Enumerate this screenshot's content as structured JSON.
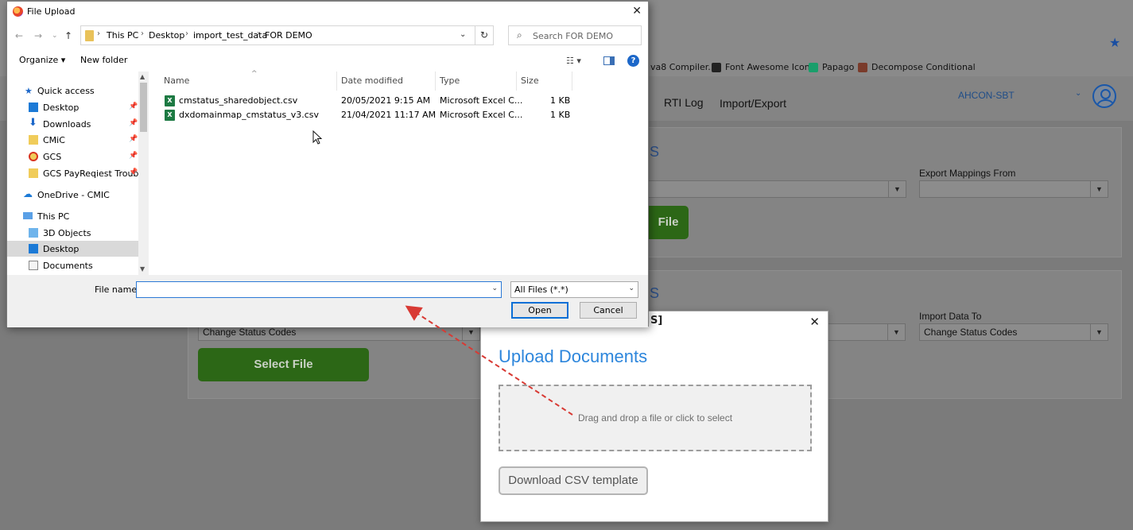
{
  "browser": {
    "bookmarks": [
      {
        "label": "va8 Compiler...",
        "icon_color": "#5a5a5a"
      },
      {
        "label": "Font Awesome Icons",
        "icon_color": "#222222"
      },
      {
        "label": "Papago",
        "icon_color": "#1a9e6b"
      },
      {
        "label": "Decompose Conditional",
        "icon_color": "#7a3b2b"
      }
    ]
  },
  "app": {
    "nav": [
      "RTI Log",
      "Import/Export"
    ],
    "org_name": "AHCON-SBT",
    "section_top": {
      "heading_fragment": "S",
      "label": "Export Mappings From",
      "button_fragment": "File"
    },
    "section_bottom": {
      "heading_fragment": "S",
      "left_select_value": "Change Status Codes",
      "label": "Import Data To",
      "right_select_value": "Change Status Codes",
      "button_label": "Select File"
    },
    "accent_green": "#2c6716"
  },
  "upload_modal": {
    "title_fragment": "S]",
    "heading": "Upload Documents",
    "dropzone_text": "Drag and drop a file or click to select",
    "template_button": "Download CSV template",
    "accent_blue": "#2d86dc"
  },
  "file_dialog": {
    "title": "File Upload",
    "breadcrumbs": [
      "This PC",
      "Desktop",
      "import_test_data",
      "FOR DEMO"
    ],
    "search_placeholder": "Search FOR DEMO",
    "toolbar": {
      "organize": "Organize",
      "new_folder": "New folder"
    },
    "nav_items": [
      {
        "label": "Quick access",
        "icon": "star-icon",
        "pinned": false,
        "indent": 0
      },
      {
        "label": "Desktop",
        "icon": "desktop-icon",
        "pinned": true,
        "indent": 1
      },
      {
        "label": "Downloads",
        "icon": "download-icon",
        "pinned": true,
        "indent": 1
      },
      {
        "label": "CMiC",
        "icon": "folder-icon",
        "pinned": true,
        "indent": 1
      },
      {
        "label": "GCS",
        "icon": "folder-alert-icon",
        "pinned": true,
        "indent": 1
      },
      {
        "label": "GCS PayReqiest Trouble",
        "icon": "folder-icon",
        "pinned": true,
        "indent": 1
      },
      {
        "label": "OneDrive - CMIC",
        "icon": "cloud-icon",
        "pinned": false,
        "indent": 0
      },
      {
        "label": "This PC",
        "icon": "pc-icon",
        "pinned": false,
        "indent": 0
      },
      {
        "label": "3D Objects",
        "icon": "cube-icon",
        "pinned": false,
        "indent": 1
      },
      {
        "label": "Desktop",
        "icon": "desktop-icon",
        "pinned": false,
        "indent": 1,
        "selected": true
      },
      {
        "label": "Documents",
        "icon": "document-icon",
        "pinned": false,
        "indent": 1
      }
    ],
    "columns": [
      "Name",
      "Date modified",
      "Type",
      "Size"
    ],
    "files": [
      {
        "name": "cmstatus_sharedobject.csv",
        "date": "20/05/2021 9:15 AM",
        "type": "Microsoft Excel C...",
        "size": "1 KB"
      },
      {
        "name": "dxdomainmap_cmstatus_v3.csv",
        "date": "21/04/2021 11:17 AM",
        "type": "Microsoft Excel C...",
        "size": "1 KB"
      }
    ],
    "file_name_label": "File name:",
    "file_name_value": "",
    "file_type_filter": "All Files (*.*)",
    "open_button": "Open",
    "cancel_button": "Cancel"
  }
}
